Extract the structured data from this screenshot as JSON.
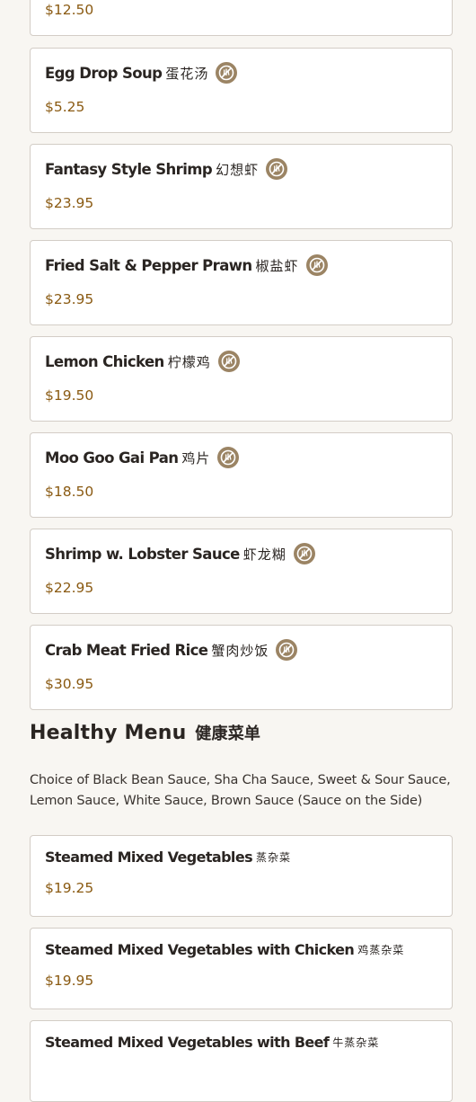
{
  "colors": {
    "background": "#f8f6f2",
    "card_border": "#d3cdc6",
    "price": "#8a5a12",
    "badge": "#9b8464"
  },
  "top_partial_card": {
    "price": "$12.50"
  },
  "menu_items": [
    {
      "name": "Egg Drop Soup",
      "chinese": "蛋花汤",
      "price": "$5.25",
      "badge_icon": "gluten-free-icon"
    },
    {
      "name": "Fantasy Style Shrimp",
      "chinese": "幻想虾",
      "price": "$23.95",
      "badge_icon": "gluten-free-icon"
    },
    {
      "name": "Fried Salt & Pepper Prawn",
      "chinese": "椒盐虾",
      "price": "$23.95",
      "badge_icon": "gluten-free-icon"
    },
    {
      "name": "Lemon Chicken",
      "chinese": "柠檬鸡",
      "price": "$19.50",
      "badge_icon": "gluten-free-icon"
    },
    {
      "name": "Moo Goo Gai Pan",
      "chinese": "鸡片",
      "price": "$18.50",
      "badge_icon": "gluten-free-icon"
    },
    {
      "name": "Shrimp w. Lobster Sauce",
      "chinese": "虾龙糊",
      "price": "$22.95",
      "badge_icon": "gluten-free-icon"
    },
    {
      "name": "Crab Meat Fried Rice",
      "chinese": "蟹肉炒饭",
      "price": "$30.95",
      "badge_icon": "gluten-free-icon"
    }
  ],
  "healthy_section": {
    "title": "Healthy Menu",
    "chinese": "健康菜单",
    "description": "Choice of Black Bean Sauce, Sha Cha Sauce, Sweet & Sour Sauce, Lemon Sauce, White Sauce, Brown Sauce (Sauce on the Side)",
    "items": [
      {
        "name": "Steamed Mixed Vegetables",
        "chinese": "蒸杂菜",
        "price": "$19.25"
      },
      {
        "name": "Steamed Mixed Vegetables with Chicken",
        "chinese": "鸡蒸杂菜",
        "price": "$19.95"
      },
      {
        "name": "Steamed Mixed Vegetables with Beef",
        "chinese": "牛蒸杂菜",
        "price": ""
      }
    ]
  }
}
